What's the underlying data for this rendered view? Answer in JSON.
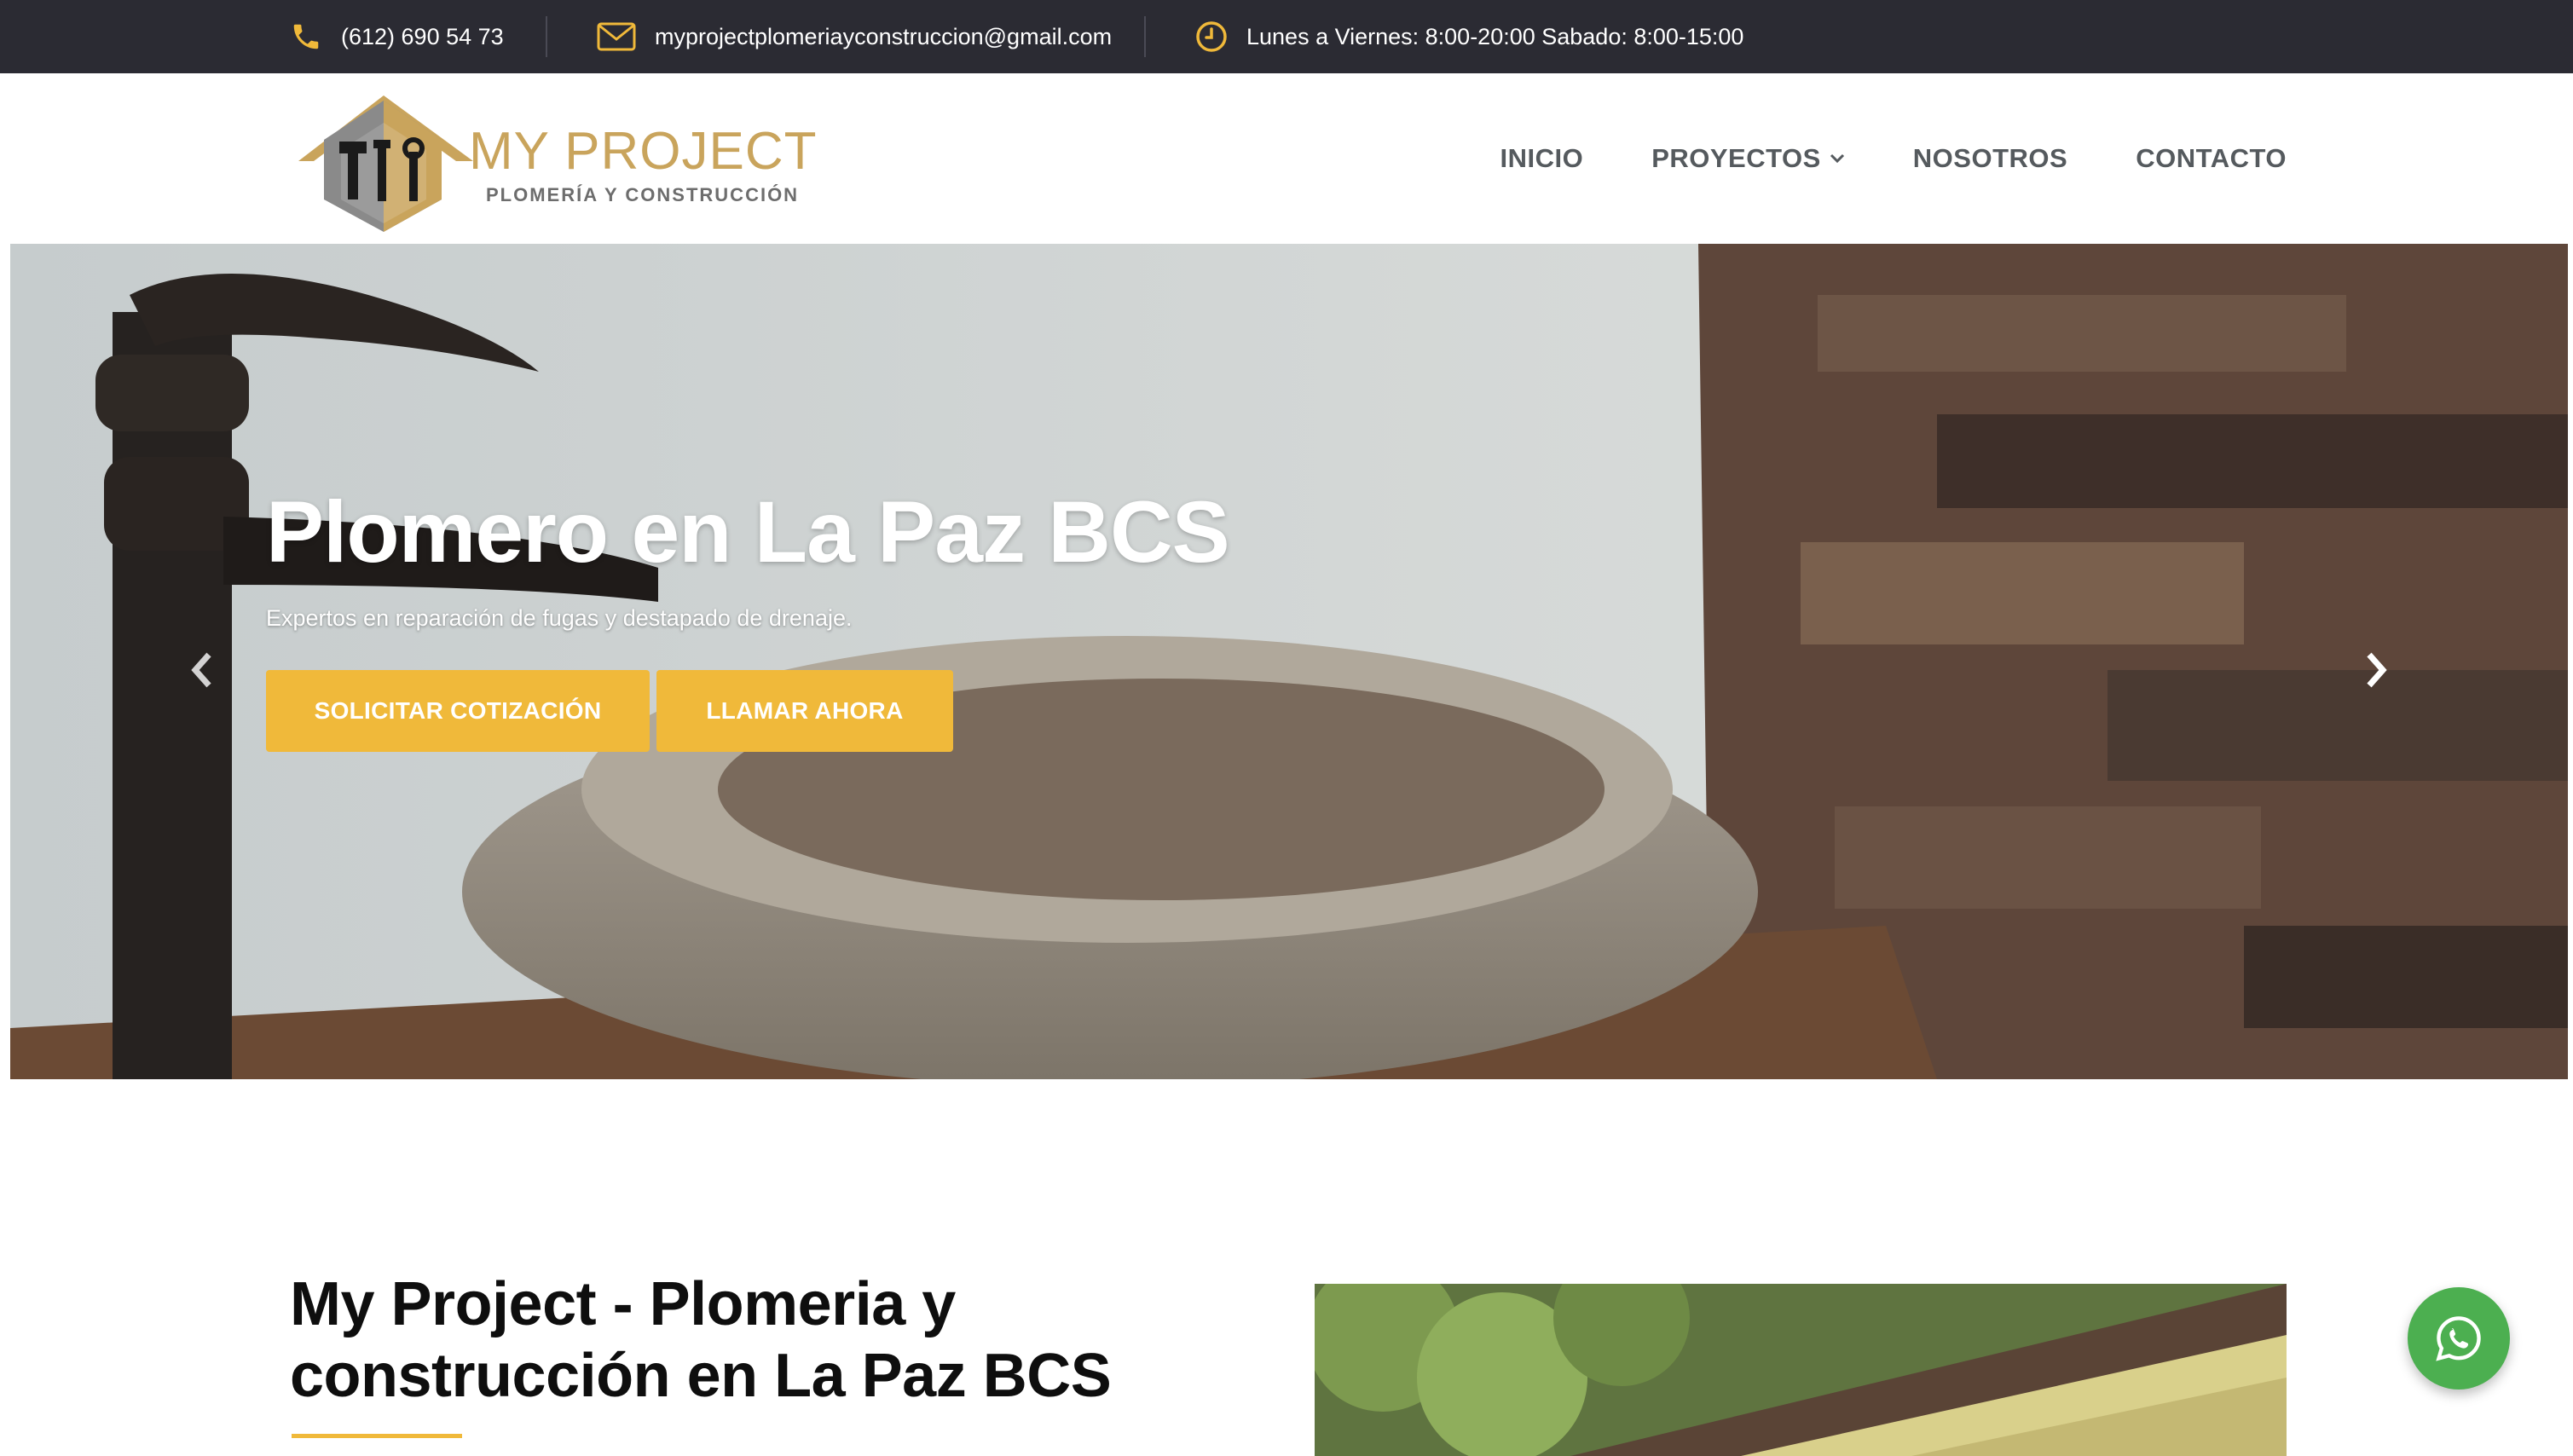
{
  "topbar": {
    "phone": "(612) 690 54 73",
    "email": "myprojectplomeriayconstruccion@gmail.com",
    "hours": "Lunes a Viernes: 8:00-20:00 Sabado: 8:00-15:00",
    "icon_color": "#f0b93a",
    "icons": [
      "phone-icon",
      "envelope-icon",
      "clock-icon"
    ]
  },
  "header": {
    "logo": {
      "title": "MY PROJECT",
      "subtitle": "PLOMERÍA Y CONSTRUCCIÓN"
    },
    "nav": [
      {
        "label": "INICIO"
      },
      {
        "label": "PROYECTOS",
        "has_dropdown": true
      },
      {
        "label": "NOSOTROS"
      },
      {
        "label": "CONTACTO"
      }
    ]
  },
  "hero": {
    "title": "Plomero en La Paz BCS",
    "subtitle": "Expertos en reparación de fugas y destapado de drenaje.",
    "buttons": [
      {
        "label": "SOLICITAR COTIZACIÓN"
      },
      {
        "label": "LLAMAR AHORA"
      }
    ],
    "prev_icon": "chevron-left-icon",
    "next_icon": "chevron-right-icon"
  },
  "about": {
    "title_line1": "My Project - Plomeria y",
    "title_line2": "construcción en La Paz BCS"
  },
  "whatsapp": {
    "icon": "whatsapp-icon",
    "color": "#4caf50"
  },
  "colors": {
    "accent": "#f0b93a",
    "topbar_bg": "#2b2b33",
    "nav_text": "#555a5e",
    "brand_gold": "#c9a45c"
  }
}
